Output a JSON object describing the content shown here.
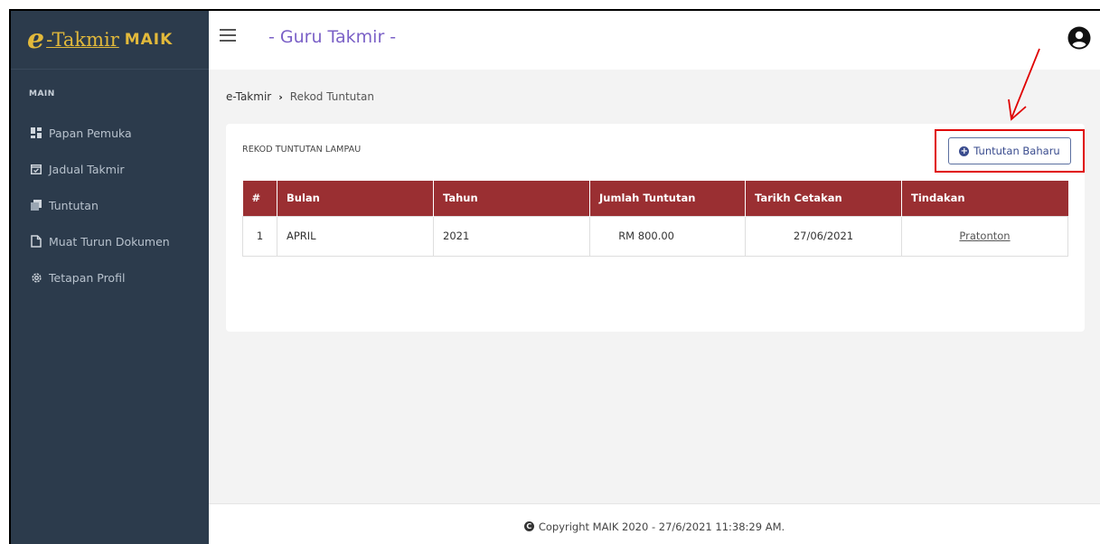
{
  "brand": {
    "e": "e",
    "takmir": "-Takmir",
    "maik": "MAIK",
    "color": "#e2b93b"
  },
  "sidebar": {
    "heading": "MAIN",
    "items": [
      {
        "label": "Papan Pemuka",
        "icon": "dashboard-icon"
      },
      {
        "label": "Jadual Takmir",
        "icon": "calendar-check-icon"
      },
      {
        "label": "Tuntutan",
        "icon": "documents-icon"
      },
      {
        "label": "Muat Turun Dokumen",
        "icon": "file-icon"
      },
      {
        "label": "Tetapan Profil",
        "icon": "gear-icon"
      }
    ]
  },
  "header": {
    "title": "- Guru Takmir -",
    "title_color": "#7b61c7"
  },
  "breadcrumb": {
    "root": "e-Takmir",
    "current": "Rekod Tuntutan"
  },
  "card": {
    "title": "REKOD TUNTUTAN LAMPAU",
    "new_button": "Tuntutan Baharu",
    "table": {
      "headers": [
        "#",
        "Bulan",
        "Tahun",
        "Jumlah Tuntutan",
        "Tarikh Cetakan",
        "Tindakan"
      ],
      "header_color": "#9a2f32",
      "rows": [
        {
          "no": "1",
          "bulan": "APRIL",
          "tahun": "2021",
          "jumlah": "RM 800.00",
          "tarikh": "27/06/2021",
          "tindakan": "Pratonton"
        }
      ]
    }
  },
  "footer": {
    "text": "Copyright MAIK 2020 - 27/6/2021 11:38:29 AM."
  }
}
